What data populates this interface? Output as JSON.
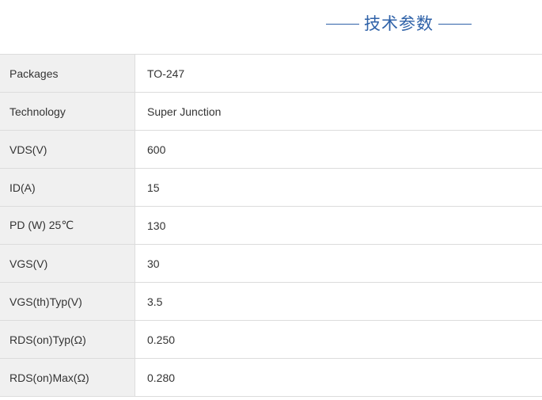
{
  "section": {
    "title": "技术参数"
  },
  "specs": [
    {
      "label": "Packages",
      "value": "TO-247"
    },
    {
      "label": "Technology",
      "value": "Super Junction"
    },
    {
      "label": "VDS(V)",
      "value": "600"
    },
    {
      "label": "ID(A)",
      "value": "15"
    },
    {
      "label": "PD (W) 25℃",
      "value": "130"
    },
    {
      "label": "VGS(V)",
      "value": "30"
    },
    {
      "label": "VGS(th)Typ(V)",
      "value": "3.5"
    },
    {
      "label": "RDS(on)Typ(Ω)",
      "value": "0.250"
    },
    {
      "label": "RDS(on)Max(Ω)",
      "value": "0.280"
    }
  ],
  "colors": {
    "accent": "#2f62a8",
    "key_cell_bg": "#f0f0f0",
    "border": "#dcdcdc",
    "text": "#333333"
  }
}
